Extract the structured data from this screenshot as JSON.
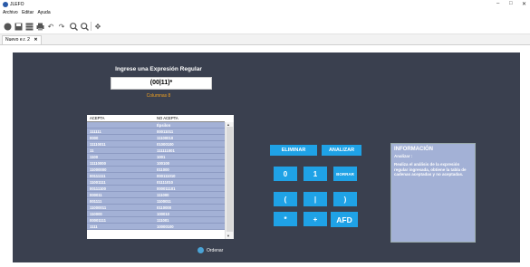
{
  "window": {
    "title": "JLEFO",
    "controls": [
      "–",
      "□",
      "✕"
    ]
  },
  "menu": [
    "Archivo",
    "Editar",
    "Ayuda"
  ],
  "toolbar": {
    "icons": [
      "record-icon",
      "save-icon",
      "table-icon",
      "print-icon",
      "undo-icon",
      "redo-icon",
      "zoom-in-icon",
      "zoom-out-icon",
      "move-icon"
    ]
  },
  "tab": {
    "label": "Nuevo e.r. 2",
    "close": "✕"
  },
  "main": {
    "prompt": "Ingrese una Expresión Regular",
    "regex_value": "(00|11)*",
    "columns_info": "Columnas 8"
  },
  "table": {
    "headers": [
      "ACEPTA",
      "NO ACEPTA"
    ],
    "rows": [
      [
        "",
        "Épsilon"
      ],
      [
        "111111",
        "00011011"
      ],
      [
        "0000",
        "11100010"
      ],
      [
        "11110011",
        "01000100"
      ],
      [
        "11",
        "111111001"
      ],
      [
        "1100",
        "1001"
      ],
      [
        "11110000",
        "100100"
      ],
      [
        "11000000",
        "011000"
      ],
      [
        "00111111",
        "000111010"
      ],
      [
        "11001111",
        "01111010"
      ],
      [
        "00111100",
        "000011101"
      ],
      [
        "000011",
        "111000"
      ],
      [
        "001111",
        "1100011"
      ],
      [
        "11000011",
        "0110000"
      ],
      [
        "110000",
        "100010"
      ],
      [
        "00001111",
        "111001"
      ],
      [
        "1111",
        "10000100"
      ]
    ]
  },
  "buttons": {
    "eliminar": "ELIMINAR",
    "analizar": "ANALIZAR",
    "zero": "0",
    "one": "1",
    "borrar": "BORRAR",
    "open_paren": "(",
    "pipe": "|",
    "close_paren": ")",
    "star": "*",
    "plus": "+",
    "afd": "AFD",
    "ordenar": "Ordenar"
  },
  "info": {
    "title": "INFORMACIÓN",
    "subtitle": "Analizar :",
    "body": "Realiza el análisis de la expresión regular ingresada, obtiene la tabla de cadenas aceptadas y no aceptadas."
  },
  "colors": {
    "panel": "#3a404f",
    "accent": "#1fa2e6",
    "table_row": "#a3b1d6",
    "info_label": "#f0a020"
  }
}
